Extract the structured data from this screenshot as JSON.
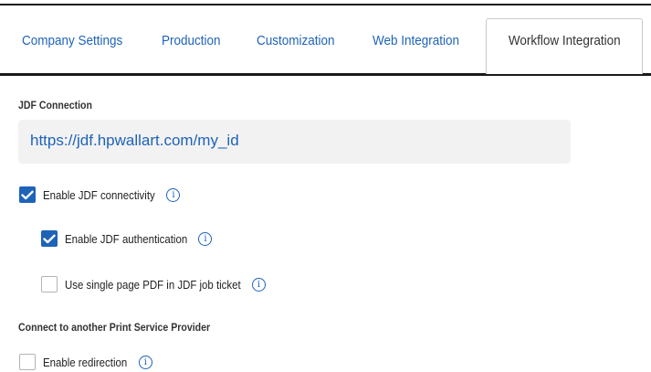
{
  "tabs": [
    {
      "label": "Company Settings",
      "active": false
    },
    {
      "label": "Production",
      "active": false
    },
    {
      "label": "Customization",
      "active": false
    },
    {
      "label": "Web Integration",
      "active": false
    },
    {
      "label": "Workflow Integration",
      "active": true
    }
  ],
  "jdf": {
    "title": "JDF Connection",
    "url": "https://jdf.hpwallart.com/my_id",
    "options": [
      {
        "label": "Enable JDF connectivity",
        "checked": true
      },
      {
        "label": "Enable JDF authentication",
        "checked": true
      },
      {
        "label": "Use single page PDF in JDF job ticket",
        "checked": false
      }
    ]
  },
  "provider": {
    "title": "Connect to another Print Service Provider",
    "options": [
      {
        "label": "Enable redirection",
        "checked": false
      }
    ]
  },
  "icons": {
    "check": "checkmark-icon",
    "info": "info-icon",
    "info_glyph": "i"
  },
  "colors": {
    "accent": "#1e63b8",
    "text": "#222222",
    "url_box_bg": "#f2f2f2"
  }
}
